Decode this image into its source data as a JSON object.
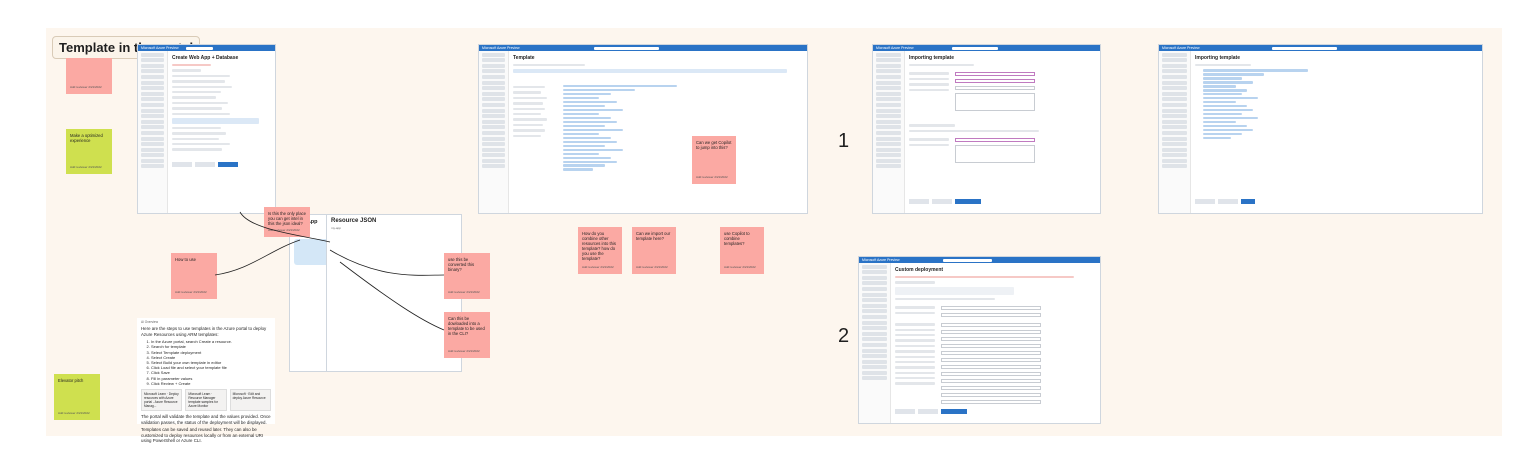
{
  "frame": {
    "title": "Template in the portal"
  },
  "stickies": {
    "left_top": {
      "text": "",
      "meta": "Add reviewer 2/21/2022"
    },
    "left_mid": {
      "text": "Make a optimized experience",
      "meta": "Add reviewer 2/21/2022"
    },
    "left_bottom": {
      "text": "Elevator pitch",
      "meta": "Add reviewer 2/21/2022"
    },
    "how_to_use": {
      "text": "How to use",
      "meta": "Add reviewer 2/21/2022"
    },
    "only_place": {
      "text": "Is this the only place you can get intel in this the json ideal?",
      "meta": "Add reviewer 2/21/2022"
    },
    "use_converted": {
      "text": "use this be converted this binary?",
      "meta": "Add reviewer 2/21/2022"
    },
    "can_downloaded": {
      "text": "Can this be dowloaded into a template to be used in the CLI?",
      "meta": "Add reviewer 2/21/2022"
    },
    "copilot_json": {
      "text": "Can we get Copilot to jump into this?",
      "meta": "Add reviewer 2/21/2022"
    },
    "combine": {
      "text": "How do you combine other resources into this template? how do you use the template?",
      "meta": "Add reviewer 2/21/2022"
    },
    "import_template": {
      "text": "Can we import our template here?",
      "meta": "Add reviewer 2/21/2022"
    },
    "use_copilot": {
      "text": "use Copilot to combine templates?",
      "meta": "Add reviewer 2/21/2022"
    }
  },
  "screenshots": {
    "brand": "Microsoft Azure Preview",
    "webapp": {
      "title": "Create Web App + Database"
    },
    "template": {
      "title": "Template"
    },
    "importing1": {
      "title": "Importing template",
      "buttons": [
        "Review + Create",
        "Previous",
        "Next: Edit Template"
      ]
    },
    "importing2": {
      "title": "Importing template"
    },
    "custom": {
      "title": "Custom deployment",
      "buttons": [
        "Previous",
        "Next",
        "Review + Create"
      ]
    },
    "webapp_front": {
      "title": "Web App"
    },
    "json": {
      "title": "Resource JSON",
      "subtitle": "my-app"
    }
  },
  "labels": {
    "step1": "1",
    "step2": "2"
  },
  "doc": {
    "header": "Ai Overview",
    "intro": "Here are the steps to use templates in the Azure portal to deploy Azure Resources using ARM templates:",
    "steps": [
      "In the Azure portal, search Create a resource.",
      "Search for template",
      "Select Template deployment",
      "Select Create",
      "Select Build your own template in editor",
      "Click Load file and select your template file",
      "Click Save",
      "Fill in parameter values",
      "Click Review + Create"
    ],
    "chips": [
      "Microsoft Learn · Deploy resources with Azure portal - Azure Resource Manag...",
      "Microsoft Learn · Resource Manager template samples for Azure Monitor",
      "Microsoft · Edit and deploy Azure Resource"
    ],
    "outro1": "The portal will validate the template and the values provided. Once validation passes, the status of the deployment will be displayed.",
    "outro2": "Templates can be saved and reused later. They can also be customized to deploy resources locally or from an external URI using PowerShell or Azure CLI."
  },
  "colors": {
    "pink": "#fba9a3",
    "green": "#cfe04f",
    "azure": "#2a73c6",
    "board": "#fdf6ee"
  }
}
